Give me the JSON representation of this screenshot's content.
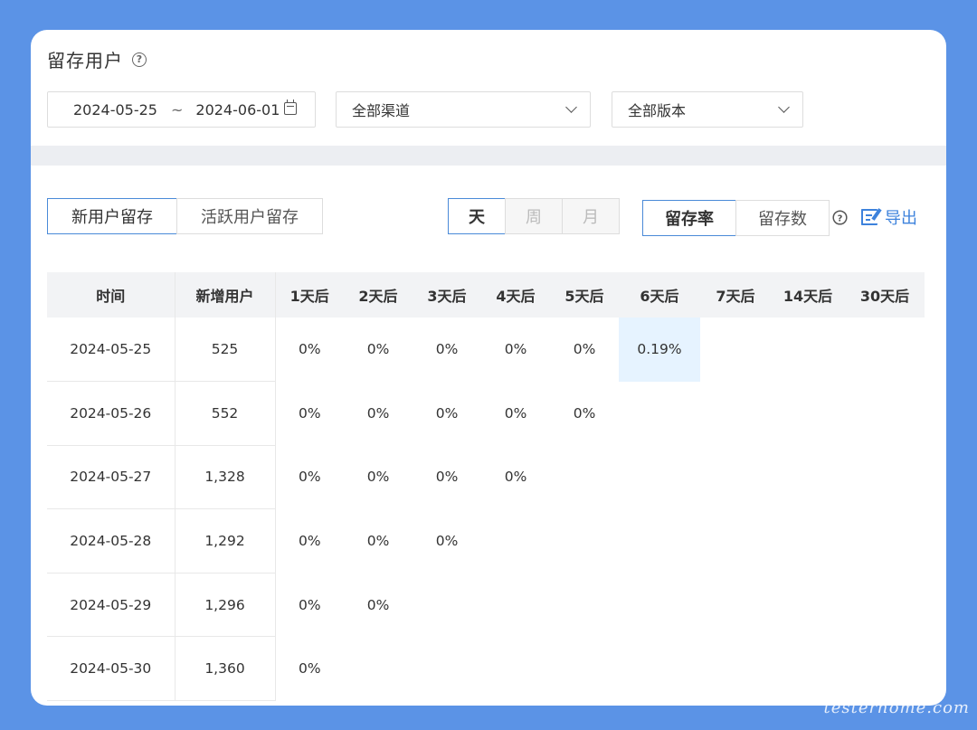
{
  "header": {
    "title": "留存用户"
  },
  "filters": {
    "date_start": "2024-05-25",
    "date_sep": "~",
    "date_end": "2024-06-01",
    "channel": "全部渠道",
    "version": "全部版本"
  },
  "user_tabs": [
    "新用户留存",
    "活跃用户留存"
  ],
  "period_tabs": [
    "天",
    "周",
    "月"
  ],
  "metric_tabs": [
    "留存率",
    "留存数"
  ],
  "export_label": "导出",
  "table": {
    "headers": [
      "时间",
      "新增用户",
      "1天后",
      "2天后",
      "3天后",
      "4天后",
      "5天后",
      "6天后",
      "7天后",
      "14天后",
      "30天后"
    ],
    "rows": [
      {
        "date": "2024-05-25",
        "new_users": "525",
        "cells": [
          "0%",
          "0%",
          "0%",
          "0%",
          "0%",
          "0.19%",
          "",
          "",
          ""
        ]
      },
      {
        "date": "2024-05-26",
        "new_users": "552",
        "cells": [
          "0%",
          "0%",
          "0%",
          "0%",
          "0%",
          "",
          "",
          "",
          ""
        ]
      },
      {
        "date": "2024-05-27",
        "new_users": "1,328",
        "cells": [
          "0%",
          "0%",
          "0%",
          "0%",
          "",
          "",
          "",
          "",
          ""
        ]
      },
      {
        "date": "2024-05-28",
        "new_users": "1,292",
        "cells": [
          "0%",
          "0%",
          "0%",
          "",
          "",
          "",
          "",
          "",
          ""
        ]
      },
      {
        "date": "2024-05-29",
        "new_users": "1,296",
        "cells": [
          "0%",
          "0%",
          "",
          "",
          "",
          "",
          "",
          "",
          ""
        ]
      },
      {
        "date": "2024-05-30",
        "new_users": "1,360",
        "cells": [
          "0%",
          "",
          "",
          "",
          "",
          "",
          "",
          "",
          ""
        ]
      }
    ]
  },
  "colors": {
    "background": "#5b93e6",
    "accent": "#3d82dc",
    "highlight": "#e6f3ff"
  },
  "watermark": "testerhome.com"
}
